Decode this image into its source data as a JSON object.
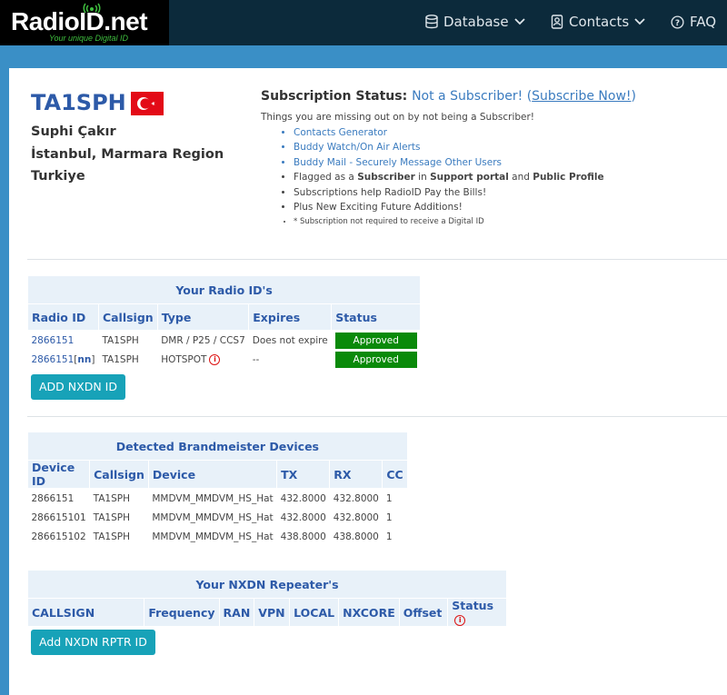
{
  "brand": {
    "logo_text": "RadioID.net",
    "tagline": "Your unique Digital ID"
  },
  "nav": {
    "database": "Database",
    "contacts": "Contacts",
    "faq": "FAQ"
  },
  "profile": {
    "callsign": "TA1SPH",
    "name": "Suphi Çakır",
    "city": "İstanbul, Marmara Region",
    "country": "Turkiye"
  },
  "subscription": {
    "label": "Subscription Status:",
    "status": "Not a Subscriber!",
    "subscribe_link": "Subscribe Now!",
    "missing_text": "Things you are missing out on by not being a Subscriber!",
    "benefits": [
      "Contacts Generator",
      "Buddy Watch/On Air Alerts",
      "Buddy Mail - Securely Message Other Users",
      "Flagged as a Subscriber in Support portal and Public Profile",
      "Subscriptions help RadioID Pay the Bills!",
      "Plus New Exciting Future Additions!",
      "* Subscription not required to receive a Digital ID"
    ]
  },
  "radio_ids": {
    "caption": "Your Radio ID's",
    "headers": [
      "Radio ID",
      "Callsign",
      "Type",
      "Expires",
      "Status"
    ],
    "rows": [
      {
        "id": "2866151",
        "suffix": "",
        "callsign": "TA1SPH",
        "type": "DMR / P25 / CCS7",
        "expires": "Does not expire",
        "status": "Approved"
      },
      {
        "id": "2866151",
        "suffix": "nn",
        "callsign": "TA1SPH",
        "type": "HOTSPOT",
        "expires": "--",
        "status": "Approved"
      }
    ],
    "add_button": "ADD NXDN ID"
  },
  "bm_devices": {
    "caption": "Detected Brandmeister Devices",
    "headers": [
      "Device ID",
      "Callsign",
      "Device",
      "TX",
      "RX",
      "CC"
    ],
    "rows": [
      {
        "id": "2866151",
        "callsign": "TA1SPH",
        "device": "MMDVM_MMDVM_HS_Hat",
        "tx": "432.8000",
        "rx": "432.8000",
        "cc": "1"
      },
      {
        "id": "286615101",
        "callsign": "TA1SPH",
        "device": "MMDVM_MMDVM_HS_Hat",
        "tx": "432.8000",
        "rx": "432.8000",
        "cc": "1"
      },
      {
        "id": "286615102",
        "callsign": "TA1SPH",
        "device": "MMDVM_MMDVM_HS_Hat",
        "tx": "438.8000",
        "rx": "438.8000",
        "cc": "1"
      }
    ]
  },
  "nxdn_repeaters": {
    "caption": "Your NXDN Repeater's",
    "headers": [
      "CALLSIGN",
      "Frequency",
      "RAN",
      "VPN",
      "LOCAL",
      "NXCORE",
      "Offset",
      "Status"
    ],
    "add_button": "Add NXDN RPTR ID"
  },
  "colors": {
    "navbar": "#0c2a3b",
    "page_bg": "#3a8fc6",
    "callsign": "#2d5aa8",
    "approved": "#0a8a0a",
    "button": "#17a2b8"
  }
}
